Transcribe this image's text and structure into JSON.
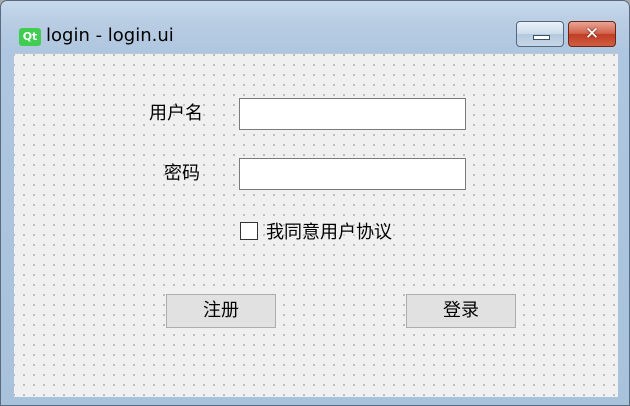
{
  "window": {
    "logo": "Qt",
    "title": "login - login.ui",
    "minimize_icon": "minimize-icon",
    "close_icon": "close-icon",
    "close_glyph": "✕"
  },
  "form": {
    "username_label": "用户名",
    "username_value": "",
    "password_label": "密码",
    "password_value": "",
    "agree_label": "我同意用户协议",
    "agree_checked": false,
    "register_button": "注册",
    "login_button": "登录"
  }
}
